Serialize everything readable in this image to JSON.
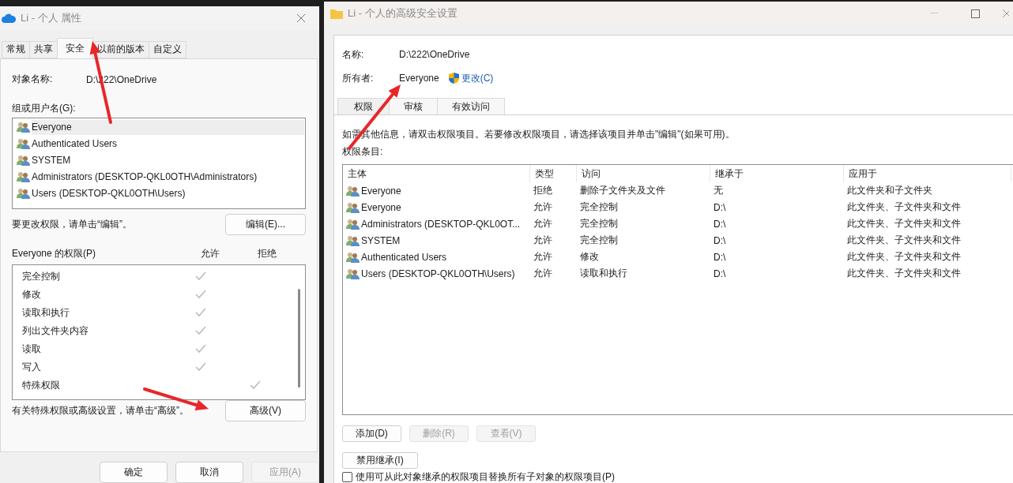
{
  "left_window": {
    "title": "Li - 个人 属性",
    "tabs": [
      {
        "label": "常规",
        "selected": false
      },
      {
        "label": "共享",
        "selected": false
      },
      {
        "label": "安全",
        "selected": true
      },
      {
        "label": "以前的版本",
        "selected": false
      },
      {
        "label": "自定义",
        "selected": false
      }
    ],
    "object_name": {
      "label": "对象名称:",
      "value": "D:\\222\\OneDrive"
    },
    "groups": {
      "label": "组或用户名(G):",
      "items": [
        {
          "name": "Everyone",
          "selected": true
        },
        {
          "name": "Authenticated Users",
          "selected": false
        },
        {
          "name": "SYSTEM",
          "selected": false
        },
        {
          "name": "Administrators (DESKTOP-QKL0OTH\\Administrators)",
          "selected": false
        },
        {
          "name": "Users (DESKTOP-QKL0OTH\\Users)",
          "selected": false
        }
      ]
    },
    "edit_hint": "要更改权限，请单击“编辑”。",
    "edit_button": "编辑(E)...",
    "permissions": {
      "label": "Everyone 的权限(P)",
      "allow_header": "允许",
      "deny_header": "拒绝",
      "items": [
        {
          "name": "完全控制",
          "allow": true,
          "deny": false
        },
        {
          "name": "修改",
          "allow": true,
          "deny": false
        },
        {
          "name": "读取和执行",
          "allow": true,
          "deny": false
        },
        {
          "name": "列出文件夹内容",
          "allow": true,
          "deny": false
        },
        {
          "name": "读取",
          "allow": true,
          "deny": false
        },
        {
          "name": "写入",
          "allow": true,
          "deny": false
        },
        {
          "name": "特殊权限",
          "allow": false,
          "deny": true
        }
      ]
    },
    "advanced_hint": "有关特殊权限或高级设置，请单击“高级”。",
    "advanced_button": "高级(V)",
    "buttons": [
      {
        "label": "确定",
        "disabled": false
      },
      {
        "label": "取消",
        "disabled": false
      },
      {
        "label": "应用(A)",
        "disabled": true
      }
    ]
  },
  "right_window": {
    "title": "Li - 个人的高级安全设置",
    "name": {
      "label": "名称:",
      "value": "D:\\222\\OneDrive"
    },
    "owner": {
      "label": "所有者:",
      "value": "Everyone",
      "change_link": "更改(C)"
    },
    "tabs": [
      {
        "label": "权限",
        "selected": true
      },
      {
        "label": "审核",
        "selected": false
      },
      {
        "label": "有效访问",
        "selected": false
      }
    ],
    "info_text": "如需其他信息，请双击权限项目。若要修改权限项目，请选择该项目并单击\"编辑\"(如果可用)。",
    "entries_label": "权限条目:",
    "table": {
      "columns": [
        "主体",
        "类型",
        "访问",
        "继承于",
        "应用于"
      ],
      "rows": [
        [
          "Everyone",
          "拒绝",
          "删除子文件夹及文件",
          "无",
          "此文件夹和子文件夹"
        ],
        [
          "Everyone",
          "允许",
          "完全控制",
          "D:\\",
          "此文件夹、子文件夹和文件"
        ],
        [
          "Administrators (DESKTOP-QKL0OT...",
          "允许",
          "完全控制",
          "D:\\",
          "此文件夹、子文件夹和文件"
        ],
        [
          "SYSTEM",
          "允许",
          "完全控制",
          "D:\\",
          "此文件夹、子文件夹和文件"
        ],
        [
          "Authenticated Users",
          "允许",
          "修改",
          "D:\\",
          "此文件夹、子文件夹和文件"
        ],
        [
          "Users (DESKTOP-QKL0OTH\\Users)",
          "允许",
          "读取和执行",
          "D:\\",
          "此文件夹、子文件夹和文件"
        ]
      ]
    },
    "entry_buttons": [
      {
        "label": "添加(D)",
        "disabled": false
      },
      {
        "label": "删除(R)",
        "disabled": true
      },
      {
        "label": "查看(V)",
        "disabled": true
      }
    ],
    "inheritance_button": "禁用继承(I)",
    "replace_checkbox": {
      "label": "使用可从此对象继承的权限项目替换所有子对象的权限项目(P)",
      "checked": false
    }
  }
}
